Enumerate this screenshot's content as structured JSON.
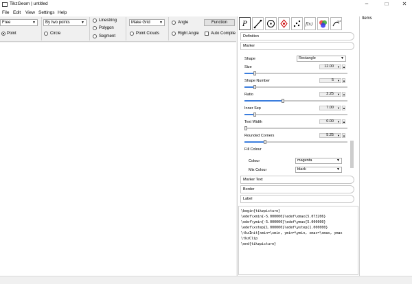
{
  "window": {
    "title": "TikzGeom | untitled"
  },
  "menu": [
    "File",
    "Edit",
    "View",
    "Settings",
    "Help"
  ],
  "toolbar": {
    "free_combo": "Free",
    "two_points_combo": "By two points",
    "make_grid_combo": "Make Grid",
    "function_button": "Function",
    "point": "Point",
    "circle": "Circle",
    "linestring": "Linestring",
    "polygon": "Polygon",
    "segment": "Segment",
    "point_clouds": "Point Clouds",
    "angle": "Angle",
    "right_angle": "Right Angle",
    "auto_compile": "Auto Compile"
  },
  "right_tabs": [
    "text-P-icon",
    "line-tool-icon",
    "circle-tool-icon",
    "point-move-icon",
    "scatter-icon",
    "function-icon",
    "color-wheel-icon",
    "transform-icon"
  ],
  "items_panel": {
    "label": "Items"
  },
  "sections": {
    "definition": "Definition",
    "marker": "Marker",
    "marker_text": "Marker Text",
    "border": "Border",
    "label": "Label"
  },
  "marker": {
    "shape_label": "Shape",
    "shape_value": "Rectangle",
    "size_label": "Size",
    "size_value": "12.00",
    "size_fraction": 0.1,
    "shape_number_label": "Shape Number",
    "shape_number_value": "5",
    "shape_number_fraction": 0.1,
    "ratio_label": "Ratio",
    "ratio_value": "2.25",
    "ratio_fraction": 0.37,
    "inner_sep_label": "Inner Sep",
    "inner_sep_value": "7.00",
    "inner_sep_fraction": 0.1,
    "text_width_label": "Text Width",
    "text_width_value": "0.00",
    "text_width_fraction": 0.0,
    "rounded_corners_label": "Rounded Corners",
    "rounded_corners_value": "5.25",
    "rounded_corners_fraction": 0.2,
    "fill_colour_label": "Fill Colour",
    "colour_label": "Colour",
    "colour_value": "magenta",
    "mix_colour_label": "Mix Colour",
    "mix_colour_value": "black"
  },
  "code": [
    "\\begin{tikzpicture}",
    "\\edef\\xmin{-5.000000}\\edef\\xmax{5.073206}",
    "\\edef\\ymin{-5.000000}\\edef\\ymax{5.000000}",
    "\\edef\\xstep{1.000000}\\edef\\ystep{1.000000}",
    "\\tkzInit[xmin=\\xmin, ymin=\\ymin, xmax=\\xmax, ymax",
    "\\tkzClip",
    "\\end{tikzpicture}"
  ]
}
